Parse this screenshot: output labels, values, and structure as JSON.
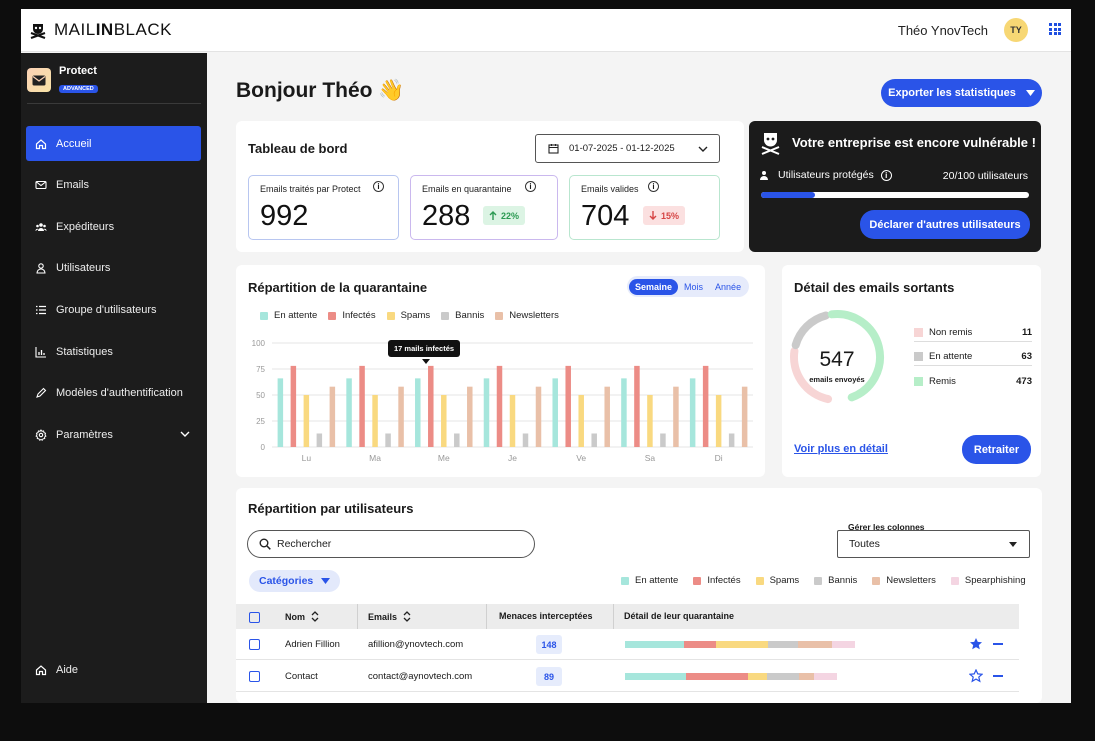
{
  "brand": {
    "wordmark_a": "MAIL",
    "wordmark_b": "IN",
    "wordmark_c": "BLACK"
  },
  "header": {
    "user_name": "Théo YnovTech",
    "avatar_initials": "TY"
  },
  "sidebar": {
    "product_name": "Protect",
    "product_badge": "ADVANCED",
    "items": [
      {
        "label": "Accueil",
        "icon": "home-icon"
      },
      {
        "label": "Emails",
        "icon": "mail-icon"
      },
      {
        "label": "Expéditeurs",
        "icon": "senders-icon"
      },
      {
        "label": "Utilisateurs",
        "icon": "user-icon"
      },
      {
        "label": "Groupe d'utilisateurs",
        "icon": "list-icon"
      },
      {
        "label": "Statistiques",
        "icon": "stats-icon"
      },
      {
        "label": "Modèles d'authentification",
        "icon": "pen-icon"
      },
      {
        "label": "Paramètres",
        "icon": "gear-icon"
      }
    ],
    "help_label": "Aide"
  },
  "page": {
    "greeting": "Bonjour Théo",
    "wave_emoji": "👋",
    "export_label": "Exporter les statistiques"
  },
  "dashboard": {
    "title": "Tableau de bord",
    "date_range": "01-07-2025 - 01-12-2025",
    "stats": [
      {
        "label": "Emails traités par Protect",
        "value": "992"
      },
      {
        "label": "Emails en quarantaine",
        "value": "288",
        "delta": "22%",
        "direction": "up"
      },
      {
        "label": "Emails valides",
        "value": "704",
        "delta": "15%",
        "direction": "down"
      }
    ]
  },
  "vulnerability": {
    "title": "Votre entreprise est encore vulnérable !",
    "protected_label": "Utilisateurs protégés",
    "protected_count": "20/100 utilisateurs",
    "protected_fraction": 0.2,
    "button_label": "Déclarer d'autres utilisateurs"
  },
  "quarantine": {
    "title": "Répartition de la quarantaine",
    "periods": [
      "Semaine",
      "Mois",
      "Année"
    ],
    "active_period": "Semaine",
    "tooltip": "17 mails infectés"
  },
  "chart_data": {
    "type": "bar",
    "categories": [
      "Lu",
      "Ma",
      "Me",
      "Je",
      "Ve",
      "Sa",
      "Di"
    ],
    "ylim": [
      0,
      100
    ],
    "yticks": [
      0,
      25,
      50,
      75,
      100
    ],
    "grid": true,
    "legend_position": "top-left",
    "series": [
      {
        "name": "En attente",
        "color": "#a6e6dc",
        "values": [
          66,
          66,
          66,
          66,
          66,
          66,
          66
        ]
      },
      {
        "name": "Infectés",
        "color": "#ec8c86",
        "values": [
          78,
          78,
          78,
          78,
          78,
          78,
          78
        ]
      },
      {
        "name": "Spams",
        "color": "#f9d980",
        "values": [
          50,
          50,
          50,
          50,
          50,
          50,
          50
        ]
      },
      {
        "name": "Bannis",
        "color": "#cacaca",
        "values": [
          13,
          13,
          13,
          13,
          13,
          13,
          13
        ]
      },
      {
        "name": "Newsletters",
        "color": "#e9c0a8",
        "values": [
          58,
          58,
          58,
          58,
          58,
          58,
          58
        ]
      }
    ]
  },
  "outgoing": {
    "title": "Détail des emails sortants",
    "total": "547",
    "total_label": "emails envoyés",
    "rows": [
      {
        "label": "Non remis",
        "value": "11",
        "color": "#f7d5d5"
      },
      {
        "label": "En attente",
        "value": "63",
        "color": "#cacaca"
      },
      {
        "label": "Remis",
        "value": "473",
        "color": "#b6eec8"
      }
    ],
    "link_label": "Voir plus en détail",
    "button_label": "Retraiter"
  },
  "users": {
    "title": "Répartition par utilisateurs",
    "search_placeholder": "Rechercher",
    "columns_label": "Gérer les colonnes",
    "columns_value": "Toutes",
    "categories_label": "Catégories",
    "legend": [
      {
        "name": "En attente",
        "color": "#a6e6dc"
      },
      {
        "name": "Infectés",
        "color": "#ec8c86"
      },
      {
        "name": "Spams",
        "color": "#f9d980"
      },
      {
        "name": "Bannis",
        "color": "#cacaca"
      },
      {
        "name": "Newsletters",
        "color": "#e9c0a8"
      },
      {
        "name": "Spearphishing",
        "color": "#f4d5e2"
      }
    ],
    "headers": {
      "name": "Nom",
      "email": "Emails",
      "threats": "Menaces interceptées",
      "detail": "Détail de leur quarantaine"
    },
    "rows": [
      {
        "name": "Adrien Fillion",
        "email": "afillion@ynovtech.com",
        "threats": "148",
        "favorite": true,
        "split": [
          0.24,
          0.13,
          0.21,
          0.12,
          0.14,
          0.09
        ]
      },
      {
        "name": "Contact",
        "email": "contact@aynovtech.com",
        "threats": "89",
        "favorite": false,
        "split": [
          0.29,
          0.29,
          0.09,
          0.15,
          0.07,
          0.11
        ]
      }
    ]
  }
}
